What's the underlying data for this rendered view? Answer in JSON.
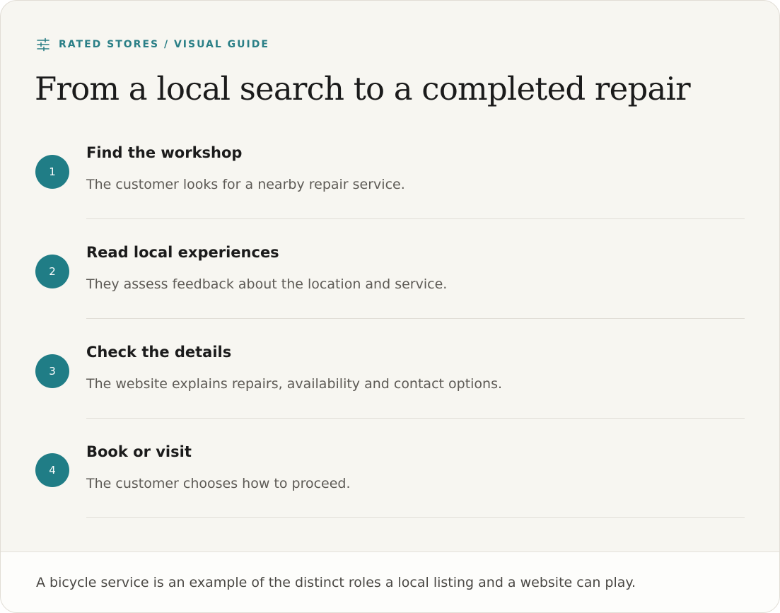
{
  "eyebrow": {
    "icon": "sliders-icon",
    "text": "RATED STORES / VISUAL GUIDE"
  },
  "title": "From a local search to a completed repair",
  "steps": [
    {
      "number": "1",
      "title": "Find the workshop",
      "description": "The customer looks for a nearby repair service."
    },
    {
      "number": "2",
      "title": "Read local experiences",
      "description": "They assess feedback about the location and service."
    },
    {
      "number": "3",
      "title": "Check the details",
      "description": "The website explains repairs, availability and contact options."
    },
    {
      "number": "4",
      "title": "Book or visit",
      "description": "The customer chooses how to proceed."
    }
  ],
  "footer": {
    "text": "A bicycle service is an example of the distinct roles a local listing and a website can play."
  },
  "colors": {
    "accent": "#207d86",
    "background": "#f7f6f1",
    "footer_background": "#fdfdfb",
    "heading": "#1b1b1b",
    "body_text": "#5d5a55"
  }
}
